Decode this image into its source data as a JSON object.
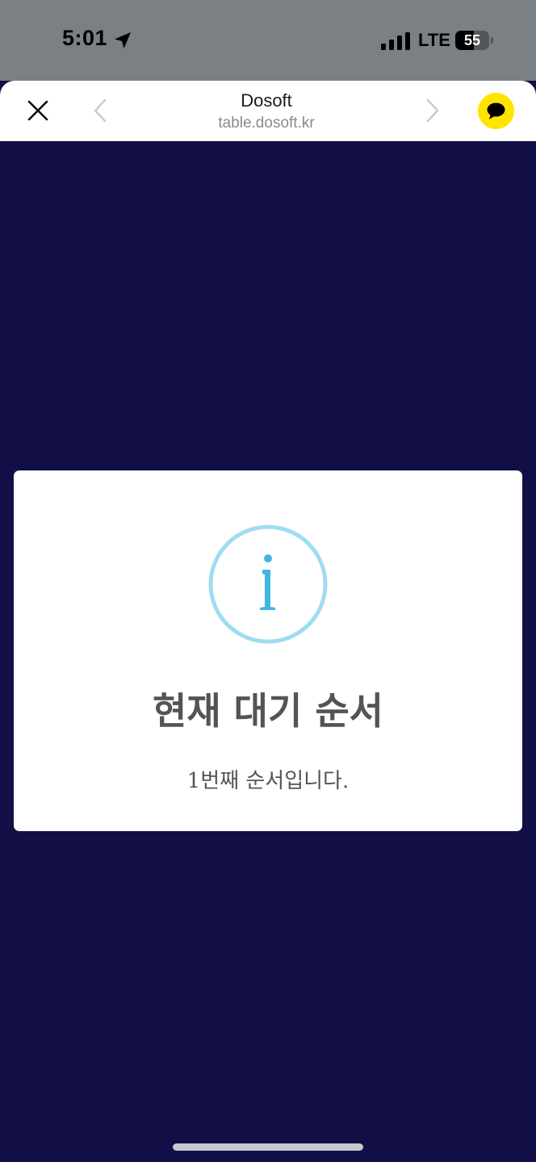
{
  "status_bar": {
    "time": "5:01",
    "network": "LTE",
    "battery_level": "55",
    "battery_fraction": 0.55,
    "icons": [
      "location-arrow-icon",
      "signal-bars-icon",
      "battery-icon"
    ]
  },
  "browser": {
    "title": "Dosoft",
    "url": "table.dosoft.kr",
    "icons": [
      "close-icon",
      "chevron-left-icon",
      "chevron-right-icon",
      "kakaotalk-chat-icon"
    ],
    "chat_button_color": "#fee500"
  },
  "modal": {
    "icon": "info-icon",
    "icon_color": "#3fb6e4",
    "icon_ring_color": "#9fdcf2",
    "title": "현재 대기 순서",
    "message": "1번째 순서입니다."
  },
  "colors": {
    "background": "#110f45",
    "status_bar": "#7b8085",
    "modal_text": "#545454"
  }
}
